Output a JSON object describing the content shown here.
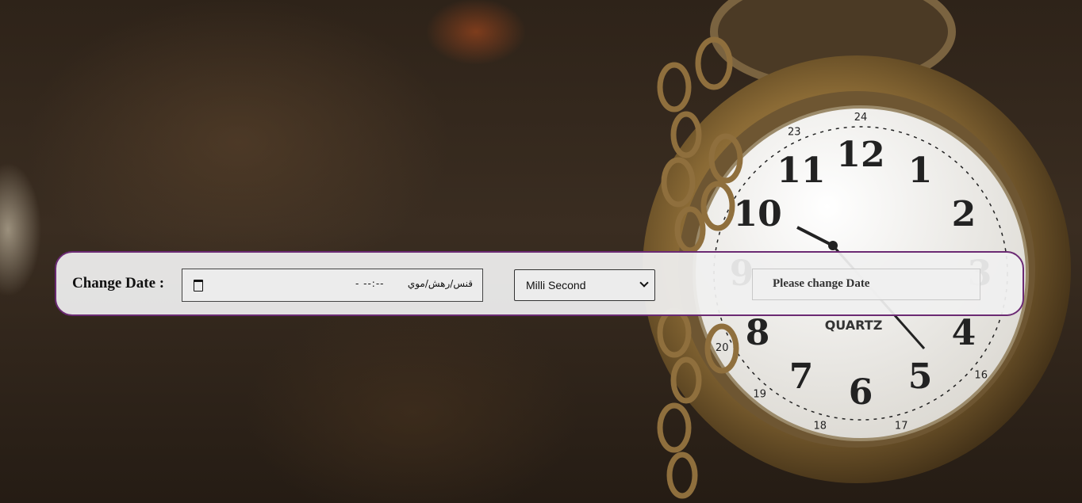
{
  "form": {
    "label": "Change Date :",
    "date_input": {
      "date_text": "قنس/رهش/موي",
      "time_text": "- --:-- "
    },
    "unit_select": {
      "selected": "Milli Second"
    },
    "result_text": "Please change Date"
  },
  "watch_face": {
    "brand": "QUARTZ",
    "hours": [
      "12",
      "1",
      "2",
      "3",
      "4",
      "5",
      "6",
      "7",
      "8",
      "9",
      "10",
      "11"
    ],
    "outer_ring": [
      "24",
      "23",
      "20",
      "19",
      "18",
      "17",
      "16"
    ]
  },
  "colors": {
    "panel_border": "#6b2a73",
    "panel_bg": "#f0f0f0"
  }
}
